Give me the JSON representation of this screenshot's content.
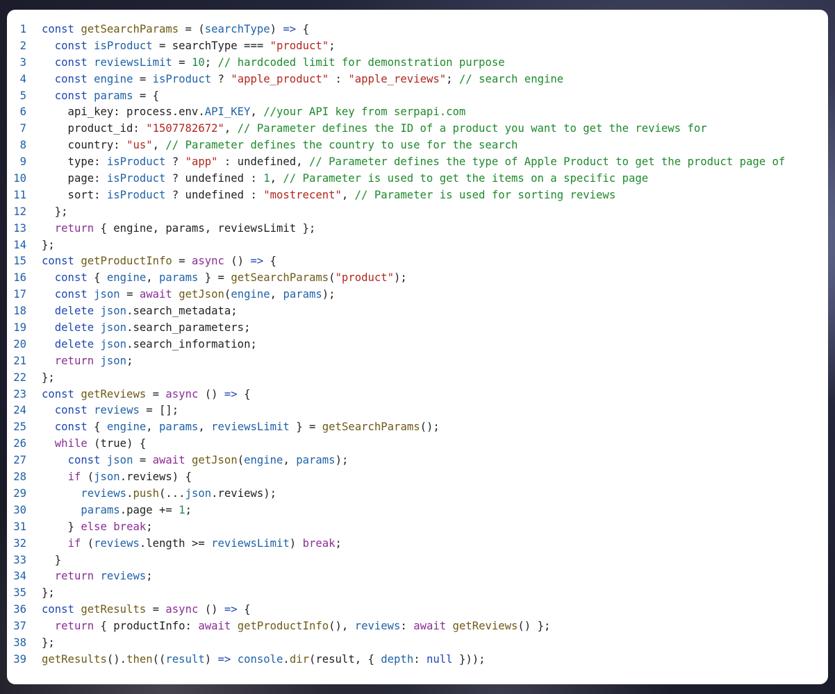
{
  "code": {
    "lines": [
      [
        [
          "k",
          "const"
        ],
        [
          "p",
          " "
        ],
        [
          "f",
          "getSearchParams"
        ],
        [
          "p",
          " = ("
        ],
        [
          "v",
          "searchType"
        ],
        [
          "p",
          ") "
        ],
        [
          "k",
          "=>"
        ],
        [
          "p",
          " {"
        ]
      ],
      [
        [
          "p",
          "  "
        ],
        [
          "k",
          "const"
        ],
        [
          "p",
          " "
        ],
        [
          "v",
          "isProduct"
        ],
        [
          "p",
          " = searchType === "
        ],
        [
          "s",
          "\"product\""
        ],
        [
          "p",
          ";"
        ]
      ],
      [
        [
          "p",
          "  "
        ],
        [
          "k",
          "const"
        ],
        [
          "p",
          " "
        ],
        [
          "v",
          "reviewsLimit"
        ],
        [
          "p",
          " = "
        ],
        [
          "n",
          "10"
        ],
        [
          "p",
          "; "
        ],
        [
          "c",
          "// hardcoded limit for demonstration purpose"
        ]
      ],
      [
        [
          "p",
          "  "
        ],
        [
          "k",
          "const"
        ],
        [
          "p",
          " "
        ],
        [
          "v",
          "engine"
        ],
        [
          "p",
          " = "
        ],
        [
          "v",
          "isProduct"
        ],
        [
          "p",
          " ? "
        ],
        [
          "s",
          "\"apple_product\""
        ],
        [
          "p",
          " : "
        ],
        [
          "s",
          "\"apple_reviews\""
        ],
        [
          "p",
          "; "
        ],
        [
          "c",
          "// search engine"
        ]
      ],
      [
        [
          "p",
          "  "
        ],
        [
          "k",
          "const"
        ],
        [
          "p",
          " "
        ],
        [
          "v",
          "params"
        ],
        [
          "p",
          " = {"
        ]
      ],
      [
        [
          "p",
          "    api_key: process.env."
        ],
        [
          "v",
          "API_KEY"
        ],
        [
          "p",
          ", "
        ],
        [
          "c",
          "//your API key from serpapi.com"
        ]
      ],
      [
        [
          "p",
          "    product_id: "
        ],
        [
          "s",
          "\"1507782672\""
        ],
        [
          "p",
          ", "
        ],
        [
          "c",
          "// Parameter defines the ID of a product you want to get the reviews for"
        ]
      ],
      [
        [
          "p",
          "    country: "
        ],
        [
          "s",
          "\"us\""
        ],
        [
          "p",
          ", "
        ],
        [
          "c",
          "// Parameter defines the country to use for the search"
        ]
      ],
      [
        [
          "p",
          "    type: "
        ],
        [
          "v",
          "isProduct"
        ],
        [
          "p",
          " ? "
        ],
        [
          "s",
          "\"app\""
        ],
        [
          "p",
          " : undefined, "
        ],
        [
          "c",
          "// Parameter defines the type of Apple Product to get the product page of"
        ]
      ],
      [
        [
          "p",
          "    page: "
        ],
        [
          "v",
          "isProduct"
        ],
        [
          "p",
          " ? undefined : "
        ],
        [
          "n",
          "1"
        ],
        [
          "p",
          ", "
        ],
        [
          "c",
          "// Parameter is used to get the items on a specific page"
        ]
      ],
      [
        [
          "p",
          "    sort: "
        ],
        [
          "v",
          "isProduct"
        ],
        [
          "p",
          " ? undefined : "
        ],
        [
          "s",
          "\"mostrecent\""
        ],
        [
          "p",
          ", "
        ],
        [
          "c",
          "// Parameter is used for sorting reviews"
        ]
      ],
      [
        [
          "p",
          "  };"
        ]
      ],
      [
        [
          "p",
          "  "
        ],
        [
          "kc",
          "return"
        ],
        [
          "p",
          " { engine, params, reviewsLimit };"
        ]
      ],
      [
        [
          "p",
          "};"
        ]
      ],
      [
        [
          "k",
          "const"
        ],
        [
          "p",
          " "
        ],
        [
          "f",
          "getProductInfo"
        ],
        [
          "p",
          " = "
        ],
        [
          "kc",
          "async"
        ],
        [
          "p",
          " () "
        ],
        [
          "k",
          "=>"
        ],
        [
          "p",
          " {"
        ]
      ],
      [
        [
          "p",
          "  "
        ],
        [
          "k",
          "const"
        ],
        [
          "p",
          " { "
        ],
        [
          "v",
          "engine"
        ],
        [
          "p",
          ", "
        ],
        [
          "v",
          "params"
        ],
        [
          "p",
          " } = "
        ],
        [
          "f",
          "getSearchParams"
        ],
        [
          "p",
          "("
        ],
        [
          "s",
          "\"product\""
        ],
        [
          "p",
          ");"
        ]
      ],
      [
        [
          "p",
          "  "
        ],
        [
          "k",
          "const"
        ],
        [
          "p",
          " "
        ],
        [
          "v",
          "json"
        ],
        [
          "p",
          " = "
        ],
        [
          "kc",
          "await"
        ],
        [
          "p",
          " "
        ],
        [
          "f",
          "getJson"
        ],
        [
          "p",
          "("
        ],
        [
          "v",
          "engine"
        ],
        [
          "p",
          ", "
        ],
        [
          "v",
          "params"
        ],
        [
          "p",
          ");"
        ]
      ],
      [
        [
          "p",
          "  "
        ],
        [
          "k",
          "delete"
        ],
        [
          "p",
          " "
        ],
        [
          "v",
          "json"
        ],
        [
          "p",
          ".search_metadata;"
        ]
      ],
      [
        [
          "p",
          "  "
        ],
        [
          "k",
          "delete"
        ],
        [
          "p",
          " "
        ],
        [
          "v",
          "json"
        ],
        [
          "p",
          ".search_parameters;"
        ]
      ],
      [
        [
          "p",
          "  "
        ],
        [
          "k",
          "delete"
        ],
        [
          "p",
          " "
        ],
        [
          "v",
          "json"
        ],
        [
          "p",
          ".search_information;"
        ]
      ],
      [
        [
          "p",
          "  "
        ],
        [
          "kc",
          "return"
        ],
        [
          "p",
          " "
        ],
        [
          "v",
          "json"
        ],
        [
          "p",
          ";"
        ]
      ],
      [
        [
          "p",
          "};"
        ]
      ],
      [
        [
          "k",
          "const"
        ],
        [
          "p",
          " "
        ],
        [
          "f",
          "getReviews"
        ],
        [
          "p",
          " = "
        ],
        [
          "kc",
          "async"
        ],
        [
          "p",
          " () "
        ],
        [
          "k",
          "=>"
        ],
        [
          "p",
          " {"
        ]
      ],
      [
        [
          "p",
          "  "
        ],
        [
          "k",
          "const"
        ],
        [
          "p",
          " "
        ],
        [
          "v",
          "reviews"
        ],
        [
          "p",
          " = [];"
        ]
      ],
      [
        [
          "p",
          "  "
        ],
        [
          "k",
          "const"
        ],
        [
          "p",
          " { "
        ],
        [
          "v",
          "engine"
        ],
        [
          "p",
          ", "
        ],
        [
          "v",
          "params"
        ],
        [
          "p",
          ", "
        ],
        [
          "v",
          "reviewsLimit"
        ],
        [
          "p",
          " } = "
        ],
        [
          "f",
          "getSearchParams"
        ],
        [
          "p",
          "();"
        ]
      ],
      [
        [
          "p",
          "  "
        ],
        [
          "kc",
          "while"
        ],
        [
          "p",
          " (true) {"
        ]
      ],
      [
        [
          "p",
          "    "
        ],
        [
          "k",
          "const"
        ],
        [
          "p",
          " "
        ],
        [
          "v",
          "json"
        ],
        [
          "p",
          " = "
        ],
        [
          "kc",
          "await"
        ],
        [
          "p",
          " "
        ],
        [
          "f",
          "getJson"
        ],
        [
          "p",
          "("
        ],
        [
          "v",
          "engine"
        ],
        [
          "p",
          ", "
        ],
        [
          "v",
          "params"
        ],
        [
          "p",
          ");"
        ]
      ],
      [
        [
          "p",
          "    "
        ],
        [
          "kc",
          "if"
        ],
        [
          "p",
          " ("
        ],
        [
          "v",
          "json"
        ],
        [
          "p",
          ".reviews) {"
        ]
      ],
      [
        [
          "p",
          "      "
        ],
        [
          "v",
          "reviews"
        ],
        [
          "p",
          "."
        ],
        [
          "f",
          "push"
        ],
        [
          "p",
          "(..."
        ],
        [
          "v",
          "json"
        ],
        [
          "p",
          ".reviews);"
        ]
      ],
      [
        [
          "p",
          "      "
        ],
        [
          "v",
          "params"
        ],
        [
          "p",
          ".page += "
        ],
        [
          "n",
          "1"
        ],
        [
          "p",
          ";"
        ]
      ],
      [
        [
          "p",
          "    } "
        ],
        [
          "kc",
          "else"
        ],
        [
          "p",
          " "
        ],
        [
          "kc",
          "break"
        ],
        [
          "p",
          ";"
        ]
      ],
      [
        [
          "p",
          "    "
        ],
        [
          "kc",
          "if"
        ],
        [
          "p",
          " ("
        ],
        [
          "v",
          "reviews"
        ],
        [
          "p",
          ".length >= "
        ],
        [
          "v",
          "reviewsLimit"
        ],
        [
          "p",
          ") "
        ],
        [
          "kc",
          "break"
        ],
        [
          "p",
          ";"
        ]
      ],
      [
        [
          "p",
          "  }"
        ]
      ],
      [
        [
          "p",
          "  "
        ],
        [
          "kc",
          "return"
        ],
        [
          "p",
          " "
        ],
        [
          "v",
          "reviews"
        ],
        [
          "p",
          ";"
        ]
      ],
      [
        [
          "p",
          "};"
        ]
      ],
      [
        [
          "k",
          "const"
        ],
        [
          "p",
          " "
        ],
        [
          "f",
          "getResults"
        ],
        [
          "p",
          " = "
        ],
        [
          "kc",
          "async"
        ],
        [
          "p",
          " () "
        ],
        [
          "k",
          "=>"
        ],
        [
          "p",
          " {"
        ]
      ],
      [
        [
          "p",
          "  "
        ],
        [
          "kc",
          "return"
        ],
        [
          "p",
          " { productInfo: "
        ],
        [
          "kc",
          "await"
        ],
        [
          "p",
          " "
        ],
        [
          "f",
          "getProductInfo"
        ],
        [
          "p",
          "(), "
        ],
        [
          "v",
          "reviews"
        ],
        [
          "p",
          ": "
        ],
        [
          "kc",
          "await"
        ],
        [
          "p",
          " "
        ],
        [
          "f",
          "getReviews"
        ],
        [
          "p",
          "() };"
        ]
      ],
      [
        [
          "p",
          "};"
        ]
      ],
      [
        [
          "f",
          "getResults"
        ],
        [
          "p",
          "()."
        ],
        [
          "f",
          "then"
        ],
        [
          "p",
          "(("
        ],
        [
          "v",
          "result"
        ],
        [
          "p",
          ") "
        ],
        [
          "k",
          "=>"
        ],
        [
          "p",
          " "
        ],
        [
          "v",
          "console"
        ],
        [
          "p",
          "."
        ],
        [
          "f",
          "dir"
        ],
        [
          "p",
          "(result, { "
        ],
        [
          "v",
          "depth"
        ],
        [
          "p",
          ": "
        ],
        [
          "k",
          "null"
        ],
        [
          "p",
          " }));"
        ]
      ]
    ]
  }
}
